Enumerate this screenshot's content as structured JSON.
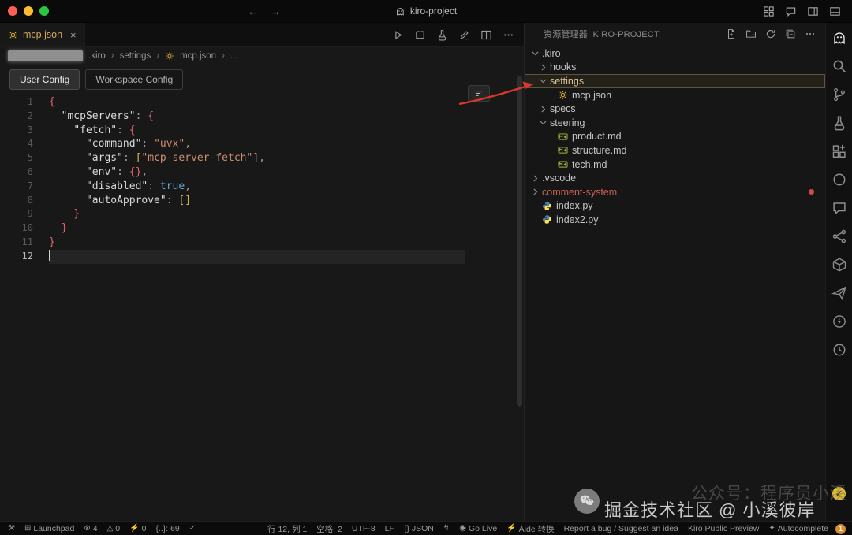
{
  "titlebar": {
    "title": "kiro-project",
    "right_icons": [
      {
        "name": "apps",
        "icon": "grid"
      },
      {
        "name": "chat",
        "icon": "chat"
      },
      {
        "name": "layout-sidebar",
        "icon": "layout-sidebar"
      },
      {
        "name": "layout-panel",
        "icon": "layout-panel"
      }
    ]
  },
  "tab": {
    "label": "mcp.json"
  },
  "editor_actions": [
    {
      "name": "run",
      "icon": "run"
    },
    {
      "name": "preview",
      "icon": "book"
    },
    {
      "name": "tests",
      "icon": "flask"
    },
    {
      "name": "edit",
      "icon": "edit"
    },
    {
      "name": "split-editor",
      "icon": "split"
    },
    {
      "name": "more-actions",
      "icon": "more"
    }
  ],
  "breadcrumb": {
    "segments": [
      ".kiro",
      "settings",
      "mcp.json",
      "..."
    ]
  },
  "config_buttons": [
    {
      "label": "User Config",
      "active": true
    },
    {
      "label": "Workspace Config",
      "active": false
    }
  ],
  "code_lines": [
    {
      "num": 1,
      "tokens": [
        [
          "pink",
          "{"
        ]
      ]
    },
    {
      "num": 2,
      "tokens": [
        [
          "ws",
          "  "
        ],
        [
          "key",
          "\"mcpServers\""
        ],
        [
          "pun",
          ": "
        ],
        [
          "pink",
          "{"
        ]
      ]
    },
    {
      "num": 3,
      "tokens": [
        [
          "ws",
          "    "
        ],
        [
          "key",
          "\"fetch\""
        ],
        [
          "pun",
          ": "
        ],
        [
          "pink",
          "{"
        ]
      ]
    },
    {
      "num": 4,
      "tokens": [
        [
          "ws",
          "      "
        ],
        [
          "key",
          "\"command\""
        ],
        [
          "pun",
          ": "
        ],
        [
          "str",
          "\"uvx\""
        ],
        [
          "pun",
          ","
        ]
      ]
    },
    {
      "num": 5,
      "tokens": [
        [
          "ws",
          "      "
        ],
        [
          "key",
          "\"args\""
        ],
        [
          "pun",
          ": "
        ],
        [
          "gold",
          "["
        ],
        [
          "str",
          "\"mcp-server-fetch\""
        ],
        [
          "gold",
          "]"
        ],
        [
          "pun",
          ","
        ]
      ]
    },
    {
      "num": 6,
      "tokens": [
        [
          "ws",
          "      "
        ],
        [
          "key",
          "\"env\""
        ],
        [
          "pun",
          ": "
        ],
        [
          "pink",
          "{}"
        ],
        [
          "pun",
          ","
        ]
      ]
    },
    {
      "num": 7,
      "tokens": [
        [
          "ws",
          "      "
        ],
        [
          "key",
          "\"disabled\""
        ],
        [
          "pun",
          ": "
        ],
        [
          "kw",
          "true"
        ],
        [
          "pun",
          ","
        ]
      ]
    },
    {
      "num": 8,
      "tokens": [
        [
          "ws",
          "      "
        ],
        [
          "key",
          "\"autoApprove\""
        ],
        [
          "pun",
          ": "
        ],
        [
          "gold",
          "[]"
        ]
      ]
    },
    {
      "num": 9,
      "tokens": [
        [
          "ws",
          "    "
        ],
        [
          "pink",
          "}"
        ]
      ]
    },
    {
      "num": 10,
      "tokens": [
        [
          "ws",
          "  "
        ],
        [
          "pink",
          "}"
        ]
      ]
    },
    {
      "num": 11,
      "tokens": [
        [
          "pink",
          "}"
        ]
      ]
    },
    {
      "num": 12,
      "tokens": [],
      "current": true
    }
  ],
  "explorer": {
    "title": "资源管理器: KIRO-PROJECT",
    "header_icons": [
      {
        "name": "new-file",
        "icon": "new-file"
      },
      {
        "name": "new-folder",
        "icon": "new-folder"
      },
      {
        "name": "refresh-explorer",
        "icon": "refresh"
      },
      {
        "name": "collapse-folders",
        "icon": "collapse-all"
      },
      {
        "name": "more",
        "icon": "more"
      }
    ],
    "items": [
      {
        "label": ".kiro",
        "kind": "folder",
        "expanded": true,
        "indent": 0
      },
      {
        "label": "hooks",
        "kind": "folder",
        "expanded": false,
        "indent": 1
      },
      {
        "label": "settings",
        "kind": "folder",
        "expanded": true,
        "indent": 1,
        "focused": true,
        "emph": true
      },
      {
        "label": "mcp.json",
        "kind": "file",
        "icon": "json",
        "indent": 2
      },
      {
        "label": "specs",
        "kind": "folder",
        "expanded": false,
        "indent": 1
      },
      {
        "label": "steering",
        "kind": "folder",
        "expanded": true,
        "indent": 1
      },
      {
        "label": "product.md",
        "kind": "file",
        "icon": "markdown",
        "indent": 2
      },
      {
        "label": "structure.md",
        "kind": "file",
        "icon": "markdown",
        "indent": 2
      },
      {
        "label": "tech.md",
        "kind": "file",
        "icon": "markdown",
        "indent": 2
      },
      {
        "label": ".vscode",
        "kind": "folder",
        "expanded": false,
        "indent": 0
      },
      {
        "label": "comment-system",
        "kind": "folder",
        "expanded": false,
        "indent": 0,
        "status": "red",
        "modified": true
      },
      {
        "label": "index.py",
        "kind": "file",
        "icon": "python",
        "indent": 0
      },
      {
        "label": "index2.py",
        "kind": "file",
        "icon": "python",
        "indent": 0
      }
    ]
  },
  "activity_bar": {
    "items": [
      {
        "name": "kiro",
        "icon": "ghost",
        "active": true
      },
      {
        "name": "search",
        "icon": "search"
      },
      {
        "name": "source-control",
        "icon": "branch"
      },
      {
        "name": "tests",
        "icon": "flask"
      },
      {
        "name": "extensions",
        "icon": "extensions"
      },
      {
        "name": "kiro-agent",
        "icon": "circle"
      },
      {
        "name": "chat",
        "icon": "chat"
      },
      {
        "name": "connections",
        "icon": "share"
      },
      {
        "name": "packages",
        "icon": "package"
      },
      {
        "name": "deploy",
        "icon": "plane"
      },
      {
        "name": "power",
        "icon": "zap"
      },
      {
        "name": "timeline",
        "icon": "history"
      }
    ]
  },
  "statusbar": {
    "left": [
      {
        "name": "remote-indicator",
        "icon": "tools",
        "text": ""
      },
      {
        "name": "launchpad",
        "icon": "grid",
        "text": "Launchpad"
      },
      {
        "name": "problems-errors",
        "icon": "error",
        "text": "4"
      },
      {
        "name": "problems-warnings",
        "icon": "warning",
        "text": "0"
      },
      {
        "name": "ports",
        "icon": "zap",
        "text": "0"
      },
      {
        "name": "bracket-count",
        "text": "{..}: 69"
      },
      {
        "name": "sync-indicator",
        "icon": "check",
        "text": ""
      }
    ],
    "right": [
      {
        "name": "cursor-position",
        "text": "行 12, 列 1"
      },
      {
        "name": "indentation",
        "text": "空格: 2"
      },
      {
        "name": "encoding",
        "text": "UTF-8"
      },
      {
        "name": "eol",
        "text": "LF"
      },
      {
        "name": "language-mode",
        "text": "{} JSON"
      },
      {
        "name": "power",
        "icon": "bolt",
        "text": ""
      },
      {
        "name": "go-live",
        "icon": "broadcast",
        "text": "Go Live"
      },
      {
        "name": "aide",
        "icon": "zap",
        "text": "Aide 转换"
      },
      {
        "name": "report-bug",
        "text": "Report a bug / Suggest an idea"
      },
      {
        "name": "kiro-preview",
        "text": "Kiro Public Preview"
      },
      {
        "name": "autocomplete",
        "icon": "sparkle",
        "text": "Autocomplete"
      }
    ],
    "badge": "1"
  },
  "watermark": {
    "primary": "掘金技术社区 @ 小溪彼岸",
    "secondary": "公众号：程序员小溪"
  }
}
